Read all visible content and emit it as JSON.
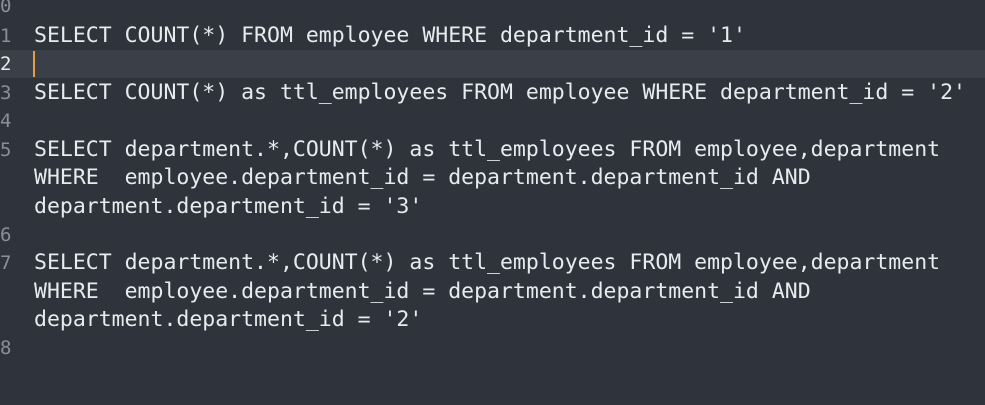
{
  "editor": {
    "line_numbers": [
      "0",
      "1",
      "2",
      "3",
      "4",
      "5",
      "6",
      "7",
      "8"
    ],
    "lines": {
      "l1": "SELECT COUNT(*) FROM employee WHERE department_id = '1'",
      "l3": "SELECT COUNT(*) as ttl_employees FROM employee WHERE department_id = '2'",
      "l5a": "SELECT department.*,COUNT(*) as ttl_employees FROM employee,department",
      "l5b": "WHERE  employee.department_id = department.department_id AND",
      "l5c": "department.department_id = '3'",
      "l7a": "SELECT department.*,COUNT(*) as ttl_employees FROM employee,department",
      "l7b": "WHERE  employee.department_id = department.department_id AND",
      "l7c": "department.department_id = '2'"
    },
    "active_line": "2",
    "colors": {
      "background": "#2f343c",
      "current_line": "#3a3f48",
      "text": "#e8ebee",
      "gutter_text": "#8a8f97",
      "caret": "#e2a144"
    }
  }
}
